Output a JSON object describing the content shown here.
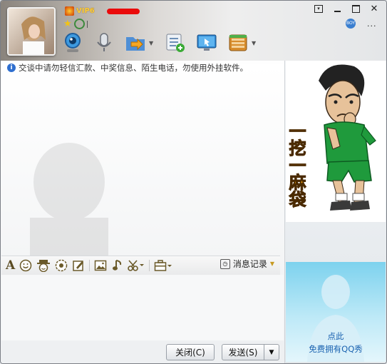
{
  "header": {
    "vip_label": "VIP6",
    "toolbar_icons": [
      "video-call-icon",
      "voice-call-icon",
      "send-file-icon",
      "share-screen-icon",
      "remote-desktop-icon",
      "app-box-icon"
    ],
    "window_controls": [
      "restore-down",
      "minimize",
      "maximize",
      "close"
    ],
    "badge_label": "BOY",
    "more_label": "..."
  },
  "chat": {
    "notice": "交谈中请勿轻信汇款、中奖信息、陌生电话，勿使用外挂软件。"
  },
  "format_toolbar": {
    "history_label": "消息记录"
  },
  "buttons": {
    "close_label": "关闭(C)",
    "send_label": "发送(S)"
  },
  "right_panel": {
    "sticker_text": "一挖一麻袋",
    "show_line1": "点此",
    "show_line2": "免费拥有QQ秀"
  },
  "colors": {
    "accent_blue": "#2f6fcf",
    "vip_gold": "#ffcf3a",
    "jersey_green": "#1f9a3c",
    "sticker_text_orange": "#f5a20a"
  }
}
